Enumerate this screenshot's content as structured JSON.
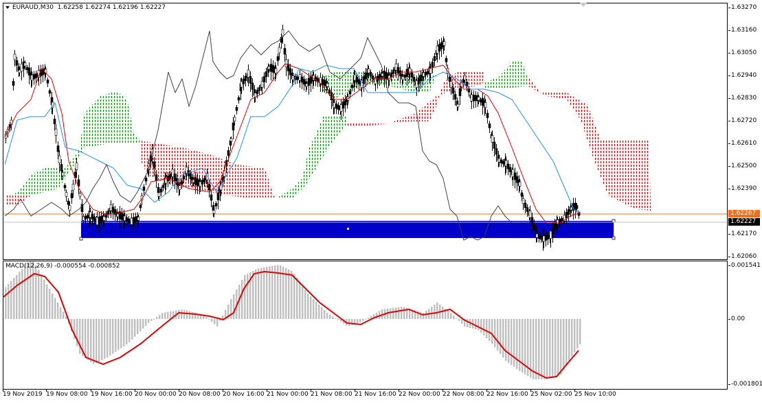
{
  "header": {
    "symbol_timeframe": "EURAUD,M30",
    "ohlc": "1.62258 1.62274 1.62196 1.62227"
  },
  "macd": {
    "label": "MACD(12,26,9) -0.000554 -0.000852",
    "ticks": [
      "0.001541",
      "0.00",
      "-0.001801"
    ],
    "histogram_color": "#c0c0c0",
    "signal_color": "#e00000"
  },
  "price_axis": {
    "ticks": [
      "1.63270",
      "1.63160",
      "1.63050",
      "1.62940",
      "1.62830",
      "1.62720",
      "1.62610",
      "1.62500",
      "1.62390",
      "1.62267",
      "1.62227",
      "1.62170",
      "1.62060"
    ],
    "ask_tag": "1.62267",
    "bid_tag": "1.62227",
    "ask_color": "#f07020",
    "bid_color": "#000000"
  },
  "time_axis": {
    "labels": [
      "19 Nov 2019",
      "19 Nov 08:00",
      "19 Nov 16:00",
      "20 Nov 00:00",
      "20 Nov 08:00",
      "20 Nov 16:00",
      "21 Nov 00:00",
      "21 Nov 08:00",
      "21 Nov 16:00",
      "22 Nov 00:00",
      "22 Nov 08:00",
      "22 Nov 16:00",
      "25 Nov 02:00",
      "25 Nov 10:00"
    ]
  },
  "colors": {
    "zone_rect": "#0000c8",
    "kumo_bull": "#008000",
    "kumo_bear": "#c00000",
    "tenkan": "#e00000",
    "kijun": "#1e90ff",
    "chikou": "#404040"
  }
}
